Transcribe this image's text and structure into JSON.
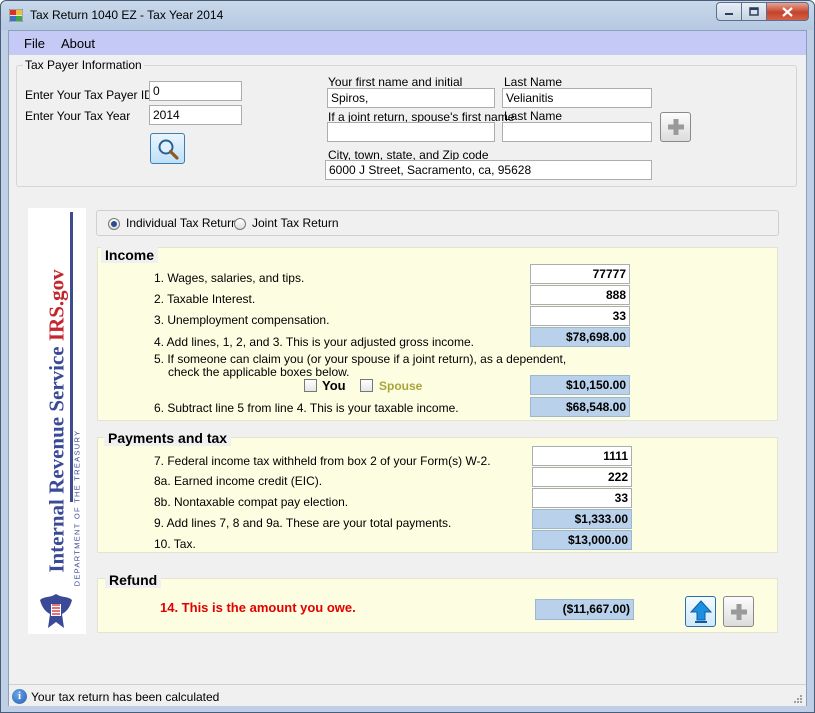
{
  "window": {
    "title": "Tax Return 1040 EZ - Tax Year 2014"
  },
  "menu": {
    "file": "File",
    "about": "About"
  },
  "taxpayer": {
    "group_title": "Tax Payer Information",
    "id_label": "Enter Your Tax Payer ID",
    "id_value": "0",
    "year_label": "Enter Your Tax Year",
    "year_value": "2014",
    "first_name_label": "Your first name and initial",
    "first_name_value": "Spiros,",
    "last_name_label": "Last Name",
    "last_name_value": "Velianitis",
    "spouse_first_label": "If a joint return, spouse's first name",
    "spouse_first_value": "",
    "spouse_last_label": "Last Name",
    "spouse_last_value": "",
    "city_label": "City, town, state, and Zip code",
    "city_value": "6000 J Street, Sacramento, ca, 95628"
  },
  "irs": {
    "main": "Internal Revenue Service ",
    "gov": "IRS.gov",
    "dept": "DEPARTMENT OF THE TREASURY"
  },
  "return_type": {
    "individual": "Individual Tax Return",
    "joint": "Joint Tax Return",
    "selected": "individual"
  },
  "income": {
    "title": "Income",
    "line1_label": "1. Wages, salaries, and tips.",
    "line1_value": "77777",
    "line2_label": "2. Taxable Interest.",
    "line2_value": "888",
    "line3_label": "3. Unemployment compensation.",
    "line3_value": "33",
    "line4_label": "4. Add lines, 1, 2, and 3. This is your adjusted gross income.",
    "line4_value": "$78,698.00",
    "line5_label_a": "5. If someone can claim you (or your spouse if a joint return), as a dependent,",
    "line5_label_b": "check the applicable boxes below.",
    "you_label": "You",
    "spouse_label": "Spouse",
    "line5_value": "$10,150.00",
    "line6_label": "6. Subtract line 5 from line 4. This is your taxable income.",
    "line6_value": "$68,548.00"
  },
  "payments": {
    "title": "Payments and tax",
    "line7_label": "7. Federal income tax withheld from box 2 of your Form(s) W-2.",
    "line7_value": "1111",
    "line8a_label": "8a. Earned income credit (EIC).",
    "line8a_value": "222",
    "line8b_label": "8b. Nontaxable compat pay election.",
    "line8b_value": "33",
    "line9_label": "9. Add lines 7, 8 and 9a. These are your total payments.",
    "line9_value": "$1,333.00",
    "line10_label": "10. Tax.",
    "line10_value": "$13,000.00"
  },
  "refund": {
    "title": "Refund",
    "line14_label": "14. This is the amount you owe.",
    "line14_value": "($11,667.00)"
  },
  "status": {
    "text": "Your tax return has been calculated"
  },
  "colors": {
    "menu_bg": "#c5c9f6",
    "calc_field": "#b9d1ea",
    "section_bg": "#fdfde2",
    "owe_text": "#e20000"
  }
}
